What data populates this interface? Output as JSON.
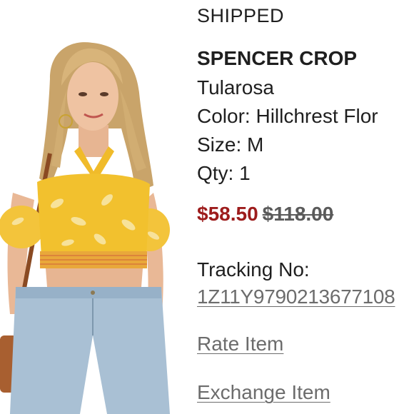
{
  "order_item": {
    "status": "SHIPPED",
    "product_name": "SPENCER CROP",
    "brand": "Tularosa",
    "color_line": "Color: Hillchrest Flor",
    "size_line": "Size: M",
    "qty_line": "Qty: 1",
    "sale_price": "$58.50",
    "original_price": "$118.00",
    "tracking_label": "Tracking No:",
    "tracking_number": "1Z11Y9790213677108",
    "rate_item_label": "Rate Item",
    "exchange_item_label": "Exchange Item"
  },
  "colors": {
    "sale_price": "#9d1c1c",
    "original_price": "#5a5a5a",
    "link": "#6c6c6c",
    "top_yellow": "#f2c12e",
    "denim": "#a9c0d4"
  }
}
